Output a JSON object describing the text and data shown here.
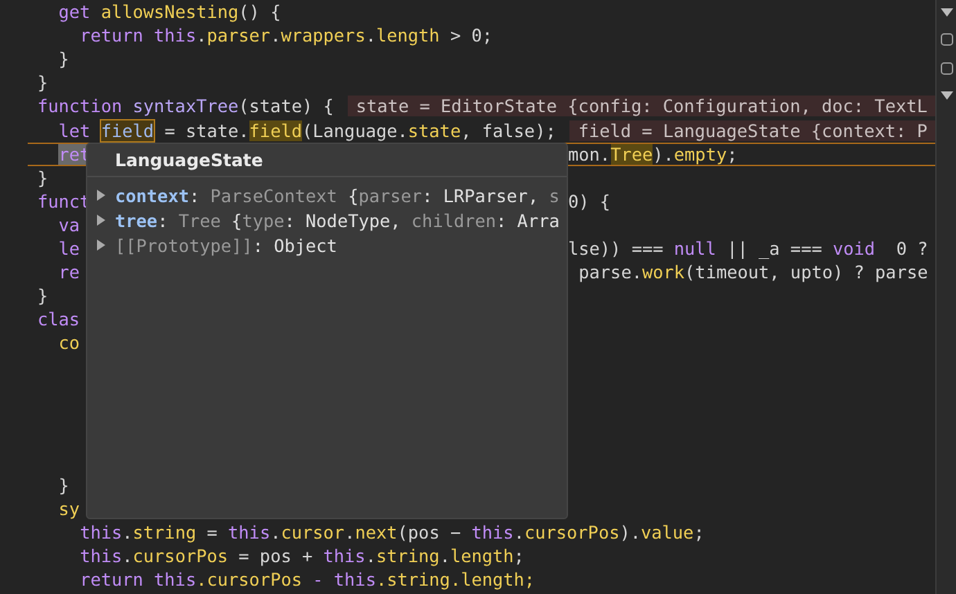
{
  "editor": {
    "lines": [
      {
        "current": false,
        "left": [
          {
            "t": "  get",
            "kind": "keyword"
          },
          {
            "t": " allowsNesting",
            "kind": "property"
          },
          {
            "t": "() {",
            "kind": "plain"
          }
        ]
      },
      {
        "current": false,
        "left": [
          {
            "t": "    return this",
            "kind": "keyword"
          },
          {
            "t": ".",
            "kind": "plain"
          },
          {
            "t": "parser",
            "kind": "property"
          },
          {
            "t": ".",
            "kind": "plain"
          },
          {
            "t": "wrappers",
            "kind": "property"
          },
          {
            "t": ".",
            "kind": "plain"
          },
          {
            "t": "length",
            "kind": "property"
          },
          {
            "t": " > 0;",
            "kind": "plain"
          }
        ]
      },
      {
        "current": false,
        "left": [
          {
            "t": "  }",
            "kind": "plain"
          }
        ]
      },
      {
        "current": false,
        "left": [
          {
            "t": "}",
            "kind": "plain"
          }
        ]
      },
      {
        "current": false,
        "left": [
          {
            "t": "function",
            "kind": "keyword"
          },
          {
            "t": " syntaxTree",
            "kind": "def"
          },
          {
            "t": "(state) {",
            "kind": "plain"
          }
        ],
        "annotation": "state = EditorState {config: Configuration, doc: TextL"
      },
      {
        "current": false,
        "left": [
          {
            "t": "  let",
            "kind": "keyword"
          },
          {
            "t": " field",
            "kind": "outlined"
          },
          {
            "t": " = state.",
            "kind": "plain"
          },
          {
            "t": "field",
            "kind": "match"
          },
          {
            "t": "(Language.",
            "kind": "plain"
          },
          {
            "t": "state",
            "kind": "property"
          },
          {
            "t": ", false);",
            "kind": "plain"
          }
        ],
        "annotation": "field = LanguageState {context: P"
      },
      {
        "current": true,
        "left": [
          {
            "t": "  ret",
            "kind": "selection"
          }
        ],
        "right": [
          {
            "t": "mon.",
            "kind": "plain"
          },
          {
            "t": "Tree",
            "kind": "match"
          },
          {
            "t": ").",
            "kind": "plain"
          },
          {
            "t": "empty",
            "kind": "property"
          },
          {
            "t": ";",
            "kind": "plain"
          }
        ]
      },
      {
        "current": false,
        "left": [
          {
            "t": "}",
            "kind": "plain"
          }
        ]
      },
      {
        "current": false,
        "left": [
          {
            "t": "funct",
            "kind": "keyword"
          }
        ],
        "right": [
          {
            "t": "0) {",
            "kind": "plain"
          }
        ]
      },
      {
        "current": false,
        "left": [
          {
            "t": "  va",
            "kind": "keyword"
          }
        ]
      },
      {
        "current": false,
        "left": [
          {
            "t": "  le",
            "kind": "keyword"
          }
        ],
        "right": [
          {
            "t": "lse)) === ",
            "kind": "plain"
          },
          {
            "t": "null",
            "kind": "keyword"
          },
          {
            "t": " || _a === ",
            "kind": "plain"
          },
          {
            "t": "void",
            "kind": "keyword"
          },
          {
            "t": "  0 ?",
            "kind": "plain"
          }
        ]
      },
      {
        "current": false,
        "left": [
          {
            "t": "  re",
            "kind": "keyword"
          }
        ],
        "right": [
          {
            "t": " parse.",
            "kind": "plain"
          },
          {
            "t": "work",
            "kind": "property"
          },
          {
            "t": "(timeout, upto) ? parse",
            "kind": "plain"
          }
        ]
      },
      {
        "current": false,
        "left": [
          {
            "t": "}",
            "kind": "plain"
          }
        ]
      },
      {
        "current": false,
        "left": [
          {
            "t": "clas",
            "kind": "keyword"
          }
        ]
      },
      {
        "current": false,
        "left": [
          {
            "t": "  co",
            "kind": "property"
          }
        ]
      },
      {
        "current": false
      },
      {
        "current": false
      },
      {
        "current": false
      },
      {
        "current": false
      },
      {
        "current": false
      },
      {
        "current": false,
        "left": [
          {
            "t": "  }",
            "kind": "plain"
          }
        ]
      },
      {
        "current": false,
        "left": [
          {
            "t": "  sy",
            "kind": "property"
          }
        ]
      },
      {
        "current": false,
        "left": [
          {
            "t": "    this",
            "kind": "keyword"
          },
          {
            "t": ".",
            "kind": "plain"
          },
          {
            "t": "string",
            "kind": "property"
          },
          {
            "t": " = ",
            "kind": "plain"
          },
          {
            "t": "this",
            "kind": "keyword"
          },
          {
            "t": ".",
            "kind": "plain"
          },
          {
            "t": "cursor",
            "kind": "property"
          },
          {
            "t": ".",
            "kind": "plain"
          },
          {
            "t": "next",
            "kind": "property"
          },
          {
            "t": "(pos − ",
            "kind": "plain"
          },
          {
            "t": "this",
            "kind": "keyword"
          },
          {
            "t": ".",
            "kind": "plain"
          },
          {
            "t": "cursorPos",
            "kind": "property"
          },
          {
            "t": ").",
            "kind": "plain"
          },
          {
            "t": "value",
            "kind": "property"
          },
          {
            "t": ";",
            "kind": "plain"
          }
        ]
      },
      {
        "current": false,
        "left": [
          {
            "t": "    this",
            "kind": "keyword"
          },
          {
            "t": ".",
            "kind": "plain"
          },
          {
            "t": "cursorPos",
            "kind": "property"
          },
          {
            "t": " = pos + ",
            "kind": "plain"
          },
          {
            "t": "this",
            "kind": "keyword"
          },
          {
            "t": ".",
            "kind": "plain"
          },
          {
            "t": "string",
            "kind": "property"
          },
          {
            "t": ".",
            "kind": "plain"
          },
          {
            "t": "length",
            "kind": "property"
          },
          {
            "t": ";",
            "kind": "plain"
          }
        ]
      },
      {
        "current": false,
        "left": [
          {
            "t": "    return this",
            "kind": "keyword"
          },
          {
            "t": ".cursorPos",
            "kind": "property"
          },
          {
            "t": " - this",
            "kind": "keyword"
          },
          {
            "t": ".string.length;",
            "kind": "property"
          }
        ]
      }
    ]
  },
  "popover": {
    "title": "LanguageState",
    "rows": [
      {
        "expanded": false,
        "parts": [
          {
            "t": "context",
            "kind": "key"
          },
          {
            "t": ": ",
            "kind": "plain"
          },
          {
            "t": "ParseContext",
            "kind": "dim"
          },
          {
            "t": " {",
            "kind": "plain"
          },
          {
            "t": "parser",
            "kind": "dim"
          },
          {
            "t": ": LRParser, ",
            "kind": "plain"
          },
          {
            "t": "s",
            "kind": "dim"
          }
        ]
      },
      {
        "expanded": false,
        "parts": [
          {
            "t": "tree",
            "kind": "key"
          },
          {
            "t": ": ",
            "kind": "plain"
          },
          {
            "t": "Tree",
            "kind": "dim"
          },
          {
            "t": " {",
            "kind": "plain"
          },
          {
            "t": "type",
            "kind": "dim"
          },
          {
            "t": ": NodeType, ",
            "kind": "plain"
          },
          {
            "t": "children",
            "kind": "dim"
          },
          {
            "t": ": Arra",
            "kind": "plain"
          }
        ]
      },
      {
        "expanded": false,
        "parts": [
          {
            "t": "[[Prototype]]",
            "kind": "dim"
          },
          {
            "t": ": Object",
            "kind": "plain"
          }
        ]
      }
    ]
  }
}
